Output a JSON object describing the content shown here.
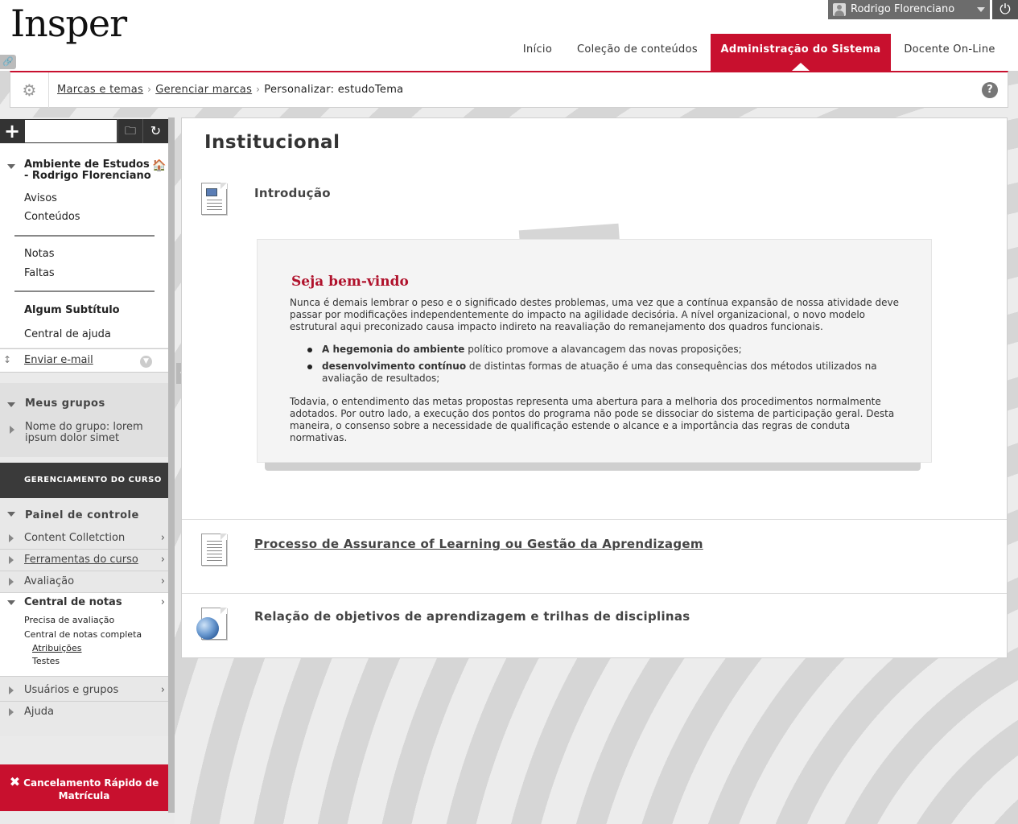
{
  "header": {
    "logo": "Insper",
    "user_name": "Rodrigo Florenciano",
    "logout_icon": "power-icon"
  },
  "nav": {
    "tabs": [
      {
        "label": "Início"
      },
      {
        "label": "Coleção de conteúdos"
      },
      {
        "label": "Administração do Sistema",
        "active": true
      },
      {
        "label": "Docente On-Line"
      }
    ]
  },
  "breadcrumb": {
    "items": [
      "Marcas e temas",
      "Gerenciar marcas"
    ],
    "current": "Personalizar: estudoTema",
    "separator": "›"
  },
  "sidebar": {
    "course_title": "Ambiente de Estudos - Rodrigo Florenciano",
    "links_group1": [
      "Avisos",
      "Conteúdos"
    ],
    "links_group2": [
      "Notas",
      "Faltas"
    ],
    "subtitle": "Algum Subtítulo",
    "help_center": "Central de ajuda",
    "send_email": "Enviar e-mail",
    "groups_header": "Meus grupos",
    "group_name": "Nome do grupo: lorem ipsum dolor simet",
    "management_header": "GERENCIAMENTO DO CURSO",
    "control_panel": "Painel de controle",
    "panel_items": [
      "Content Colletction",
      "Ferramentas do curso",
      "Avaliação",
      "Central de notas"
    ],
    "grade_center_items": [
      "Precisa de avaliação",
      "Central de notas completa"
    ],
    "grade_center_sub": [
      "Atribuições",
      "Testes"
    ],
    "users_groups": "Usuários e grupos",
    "help": "Ajuda",
    "cancel_button": "Cancelamento Rápido de Matrícula"
  },
  "main": {
    "title": "Institucional",
    "item1_title": "Introdução",
    "welcome": {
      "heading": "Seja bem-vindo",
      "p1": "Nunca é demais lembrar o peso e o significado destes problemas, uma vez que a contínua expansão de nossa atividade deve passar por modificações independentemente do impacto na agilidade decisória. A nível organizacional, o novo modelo estrutural aqui preconizado causa impacto indireto na reavaliação do remanejamento dos quadros funcionais.",
      "li1_bold": "A hegemonia do ambiente",
      "li1_rest": " político promove a alavancagem das novas proposições;",
      "li2_bold": "desenvolvimento contínuo",
      "li2_rest": " de distintas formas de atuação é uma das consequências dos métodos utilizados na avaliação de resultados;",
      "p2": "Todavia, o entendimento das metas propostas representa uma abertura para a melhoria dos procedimentos normalmente adotados. Por outro lado, a execução dos pontos do programa não pode se dissociar do sistema de participação geral. Desta maneira, o consenso sobre a necessidade de qualificação estende o alcance e a importância das regras de conduta normativas."
    },
    "item2_title": "Processo de Assurance of Learning ou Gestão da Aprendizagem",
    "item3_title": "Relação de objetivos de aprendizagem e trilhas de disciplinas"
  }
}
